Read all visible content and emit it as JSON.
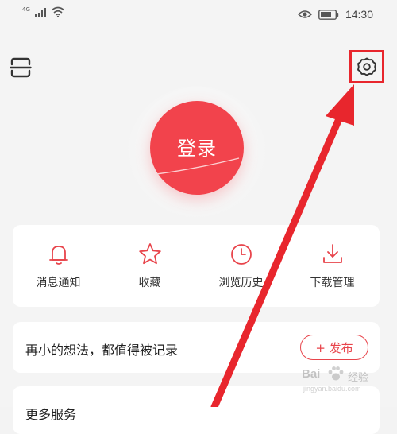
{
  "status_bar": {
    "network": "4G",
    "time": "14:30"
  },
  "icons": {
    "scan": "scan-icon",
    "settings": "gear-icon"
  },
  "login": {
    "label": "登录"
  },
  "quick_actions": [
    {
      "label": "消息通知",
      "icon": "bell-icon"
    },
    {
      "label": "收藏",
      "icon": "star-icon"
    },
    {
      "label": "浏览历史",
      "icon": "clock-icon"
    },
    {
      "label": "下载管理",
      "icon": "download-icon"
    }
  ],
  "publish": {
    "prompt": "再小的想法，都值得被记录",
    "button_label": "+ 发布"
  },
  "next_card": {
    "title": "更多服务"
  },
  "watermark": {
    "brand": "Bai",
    "brand_cn": "经验",
    "url": "jingyan.baidu.com"
  },
  "colors": {
    "accent": "#f2434c",
    "highlight": "#e8262d",
    "background": "#f4f4f4"
  }
}
